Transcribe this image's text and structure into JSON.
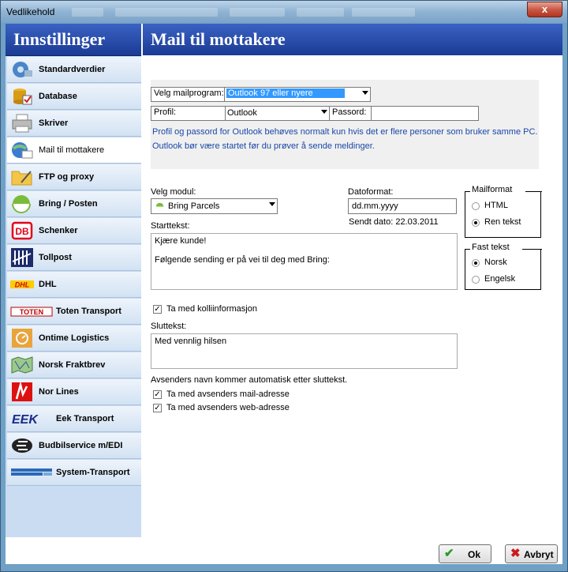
{
  "window": {
    "title": "Vedlikehold",
    "close_label": "x"
  },
  "left_header": "Innstillinger",
  "right_header": "Mail til mottakere",
  "nav": [
    {
      "label": "Standardverdier",
      "icon": "settings-icon"
    },
    {
      "label": "Database",
      "icon": "database-icon"
    },
    {
      "label": "Skriver",
      "icon": "printer-icon"
    },
    {
      "label": "Mail til mottakere",
      "icon": "mail-globe-icon"
    },
    {
      "label": "FTP og proxy",
      "icon": "folder-icon"
    },
    {
      "label": "Bring / Posten",
      "icon": "bring-logo-icon"
    },
    {
      "label": "Schenker",
      "icon": "db-schenker-logo-icon",
      "logo_text": "DB"
    },
    {
      "label": "Tollpost",
      "icon": "tollpost-logo-icon"
    },
    {
      "label": "DHL",
      "icon": "dhl-logo-icon",
      "logo_text": "DHL"
    },
    {
      "label": "Toten Transport",
      "icon": "toten-logo-icon",
      "logo_text": "TOTEN"
    },
    {
      "label": "Ontime Logistics",
      "icon": "ontime-logo-icon"
    },
    {
      "label": "Norsk Fraktbrev",
      "icon": "map-icon"
    },
    {
      "label": "Nor Lines",
      "icon": "norlines-logo-icon"
    },
    {
      "label": "Eek Transport",
      "icon": "eek-logo-icon",
      "logo_text": "EEK"
    },
    {
      "label": "Budbilservice m/EDI",
      "icon": "budbil-logo-icon"
    },
    {
      "label": "System-Transport",
      "icon": "system-transport-logo-icon"
    }
  ],
  "mail": {
    "program_label": "Velg mailprogram:",
    "program_value": "Outlook 97 eller nyere",
    "profile_label": "Profil:",
    "profile_value": "Outlook",
    "password_label": "Passord:",
    "password_value": "",
    "info_line1": "Profil og passord for Outlook behøves normalt kun hvis det er flere personer som bruker samme PC.",
    "info_line2": "Outlook bør være startet før du prøver å sende meldinger."
  },
  "module": {
    "label": "Velg modul:",
    "value": "Bring Parcels"
  },
  "dateformat": {
    "label": "Datoformat:",
    "value": "dd.mm.yyyy",
    "sent_date": "Sendt dato: 22.03.2011"
  },
  "mailformat": {
    "title": "Mailformat",
    "options": [
      "HTML",
      "Ren tekst"
    ],
    "selected": "Ren tekst"
  },
  "fasttekst": {
    "title": "Fast tekst",
    "options": [
      "Norsk",
      "Engelsk"
    ],
    "selected": "Norsk"
  },
  "starttext": {
    "label": "Starttekst:",
    "line1": "Kjære kunde!",
    "line2": "Følgende sending er på vei til deg med Bring:"
  },
  "include_package": {
    "label": "Ta med kolliinformasjon",
    "checked": true
  },
  "endtext": {
    "label": "Sluttekst:",
    "value": "Med vennlig hilsen"
  },
  "sender_note": "Avsenders navn kommer automatisk etter sluttekst.",
  "include_email": {
    "label": "Ta med avsenders mail-adresse",
    "checked": true
  },
  "include_web": {
    "label": "Ta med avsenders web-adresse",
    "checked": true
  },
  "buttons": {
    "ok": "Ok",
    "cancel": "Avbryt"
  },
  "colors": {
    "header_blue": "#1b3b93",
    "sidebar": "#c9dcf2",
    "selection": "#3399ff",
    "info_text": "#1a47a8"
  }
}
